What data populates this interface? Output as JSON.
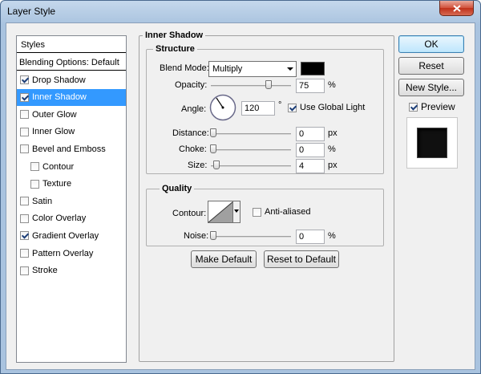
{
  "window": {
    "title": "Layer Style"
  },
  "styles": {
    "header": "Styles",
    "blending": "Blending Options: Default",
    "items": [
      {
        "label": "Drop Shadow",
        "checked": true
      },
      {
        "label": "Inner Shadow",
        "checked": true
      },
      {
        "label": "Outer Glow",
        "checked": false
      },
      {
        "label": "Inner Glow",
        "checked": false
      },
      {
        "label": "Bevel and Emboss",
        "checked": false
      },
      {
        "label": "Contour",
        "checked": false
      },
      {
        "label": "Texture",
        "checked": false
      },
      {
        "label": "Satin",
        "checked": false
      },
      {
        "label": "Color Overlay",
        "checked": false
      },
      {
        "label": "Gradient Overlay",
        "checked": true
      },
      {
        "label": "Pattern Overlay",
        "checked": false
      },
      {
        "label": "Stroke",
        "checked": false
      }
    ],
    "selected": "Inner Shadow"
  },
  "inner_shadow": {
    "section_title": "Inner Shadow",
    "structure": {
      "title": "Structure",
      "blend_mode_label": "Blend Mode:",
      "blend_mode_value": "Multiply",
      "color": "#000000",
      "opacity_label": "Opacity:",
      "opacity_value": "75",
      "opacity_unit": "%",
      "angle_label": "Angle:",
      "angle_value": "120",
      "angle_unit": "°",
      "global_light_label": "Use Global Light",
      "global_light_checked": true,
      "distance_label": "Distance:",
      "distance_value": "0",
      "distance_unit": "px",
      "choke_label": "Choke:",
      "choke_value": "0",
      "choke_unit": "%",
      "size_label": "Size:",
      "size_value": "4",
      "size_unit": "px"
    },
    "quality": {
      "title": "Quality",
      "contour_label": "Contour:",
      "anti_aliased_label": "Anti-aliased",
      "anti_aliased_checked": false,
      "noise_label": "Noise:",
      "noise_value": "0",
      "noise_unit": "%"
    },
    "make_default": "Make Default",
    "reset_default": "Reset to Default"
  },
  "actions": {
    "ok": "OK",
    "reset": "Reset",
    "new_style": "New Style...",
    "preview_label": "Preview",
    "preview_checked": true
  }
}
